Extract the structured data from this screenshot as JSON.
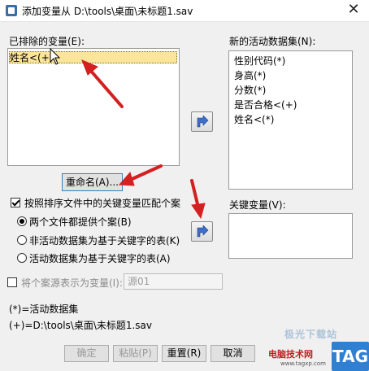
{
  "window": {
    "title": "添加变量从 D:\\tools\\桌面\\未标题1.sav",
    "close_glyph": "✕"
  },
  "excluded": {
    "label": "已排除的变量(E):",
    "items": [
      "姓名<(+)"
    ],
    "selected_index": 0,
    "rename_button": "重命名(A)..."
  },
  "new_active": {
    "label": "新的活动数据集(N):",
    "items": [
      "性别代码(*)",
      "身高(*)",
      "分数(*)",
      "是否合格<(+)",
      "姓名<(*)"
    ]
  },
  "match": {
    "checkbox_label": "按照排序文件中的关键变量匹配个案",
    "checked": true,
    "options": [
      {
        "label": "两个文件都提供个案(B)",
        "selected": true
      },
      {
        "label": "非活动数据集为基于关键字的表(K)",
        "selected": false
      },
      {
        "label": "活动数据集为基于关键字的表(A)",
        "selected": false
      }
    ]
  },
  "key_vars": {
    "label": "关键变量(V):",
    "items": []
  },
  "source": {
    "checkbox_label": "将个案源表示为变量(I):",
    "checked": false,
    "field_value": "源01"
  },
  "legend": {
    "active": "(*)=活动数据集",
    "file": "(+)=D:\\tools\\桌面\\未标题1.sav"
  },
  "buttons": {
    "ok": "确定",
    "paste": "粘贴(P)",
    "reset": "重置(R)",
    "cancel": "取消"
  },
  "watermark": {
    "badge": "TAG",
    "site_name": "电脑技术网",
    "top_text": "极光下载站",
    "url": "www.tagxp.com"
  },
  "colors": {
    "selection": "#fae59a",
    "arrow_button": "#3d6fc9",
    "annotation_arrow": "#d42020"
  }
}
